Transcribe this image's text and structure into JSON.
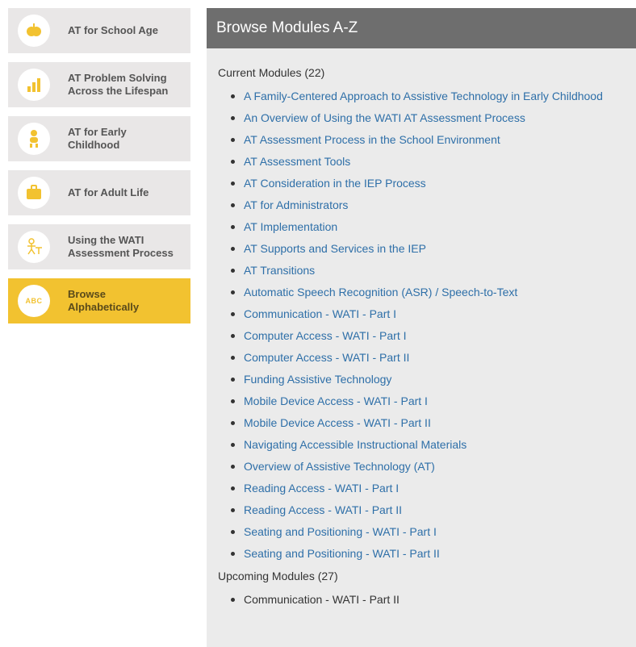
{
  "colors": {
    "sidebar_bg": "#e9e7e7",
    "sidebar_active_bg": "#f2c230",
    "accent_yellow": "#f2c230",
    "header_bg": "#6e6e6e",
    "link": "#2e6fa8"
  },
  "sidebar": {
    "items": [
      {
        "label": "AT for School Age",
        "icon": "apple-icon"
      },
      {
        "label": "AT Problem Solving\nAcross the Lifespan",
        "icon": "bar-chart-icon"
      },
      {
        "label": "AT for Early\nChildhood",
        "icon": "child-icon"
      },
      {
        "label": "AT for Adult Life",
        "icon": "briefcase-icon"
      },
      {
        "label": "Using the WATI\nAssessment Process",
        "icon": "person-at-desk-icon"
      },
      {
        "label": "Browse\nAlphabetically",
        "icon": "abc-icon",
        "icon_text": "ABC",
        "active": true
      }
    ]
  },
  "main": {
    "header": "Browse Modules A-Z",
    "current_title": "Current Modules (22)",
    "current_modules": [
      "A Family-Centered Approach to Assistive Technology in Early Childhood",
      "An Overview of Using the WATI AT Assessment Process",
      "AT Assessment Process in the School Environment",
      "AT Assessment Tools",
      "AT Consideration in the IEP Process",
      "AT for Administrators",
      "AT Implementation",
      "AT Supports and Services in the IEP",
      "AT Transitions",
      "Automatic Speech Recognition (ASR) / Speech-to-Text",
      "Communication - WATI - Part I",
      "Computer Access - WATI - Part I",
      "Computer Access - WATI - Part II",
      "Funding Assistive Technology",
      "Mobile Device Access - WATI - Part I",
      "Mobile Device Access - WATI - Part II",
      "Navigating Accessible Instructional Materials",
      "Overview of Assistive Technology (AT)",
      "Reading Access - WATI - Part I",
      "Reading Access - WATI - Part II",
      "Seating and Positioning - WATI - Part I",
      "Seating and Positioning - WATI - Part II"
    ],
    "upcoming_title": "Upcoming Modules (27)",
    "upcoming_modules": [
      "Communication - WATI - Part II"
    ]
  }
}
